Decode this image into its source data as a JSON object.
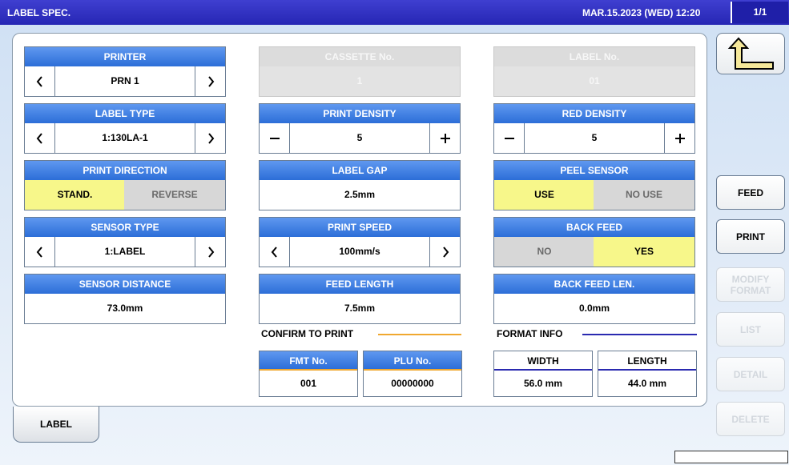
{
  "titlebar": {
    "title": "LABEL SPEC.",
    "datetime": "MAR.15.2023 (WED)  12:20",
    "page": "1/1"
  },
  "groups": {
    "printer": {
      "title": "PRINTER",
      "value": "PRN 1"
    },
    "cassette": {
      "title": "CASSETTE No.",
      "value": "1"
    },
    "label_no": {
      "title": "LABEL No.",
      "value": "01"
    },
    "label_type": {
      "title": "LABEL TYPE",
      "value": "1:130LA-1"
    },
    "print_density": {
      "title": "PRINT DENSITY",
      "value": "5"
    },
    "red_density": {
      "title": "RED DENSITY",
      "value": "5"
    },
    "print_direction": {
      "title": "PRINT DIRECTION",
      "option1": "STAND.",
      "option2": "REVERSE",
      "selected": "STAND."
    },
    "label_gap": {
      "title": "LABEL GAP",
      "value": "2.5mm"
    },
    "peel_sensor": {
      "title": "PEEL SENSOR",
      "option1": "USE",
      "option2": "NO USE",
      "selected": "USE"
    },
    "sensor_type": {
      "title": "SENSOR TYPE",
      "value": "1:LABEL"
    },
    "print_speed": {
      "title": "PRINT SPEED",
      "value": "100mm/s"
    },
    "back_feed": {
      "title": "BACK FEED",
      "option1": "NO",
      "option2": "YES",
      "selected": "YES"
    },
    "sensor_distance": {
      "title": "SENSOR DISTANCE",
      "value": "73.0mm"
    },
    "feed_length": {
      "title": "FEED LENGTH",
      "value": "7.5mm"
    },
    "back_feed_len": {
      "title": "BACK FEED LEN.",
      "value": "0.0mm"
    }
  },
  "confirm": {
    "title": "CONFIRM TO PRINT",
    "fmt": {
      "label": "FMT No.",
      "value": "001"
    },
    "plu": {
      "label": "PLU No.",
      "value": "00000000"
    }
  },
  "format_info": {
    "title": "FORMAT INFO",
    "width": {
      "label": "WIDTH",
      "value": "56.0 mm"
    },
    "length": {
      "label": "LENGTH",
      "value": "44.0 mm"
    }
  },
  "sidebar": {
    "feed": "FEED",
    "print": "PRINT",
    "modify_line1": "MODIFY",
    "modify_line2": "FORMAT",
    "list": "LIST",
    "detail": "DETAIL",
    "delete": "DELETE"
  },
  "tabs": {
    "label": "LABEL"
  },
  "icons": {
    "back": "return-arrow-icon",
    "decrease": "chevron-left-icon",
    "increase": "chevron-right-icon",
    "minus": "minus-icon",
    "plus": "plus-icon"
  },
  "colors": {
    "titlebar": "#2a2ab8",
    "group_header": "#3c7ce0",
    "selected_toggle": "#f7f78a",
    "unselected_toggle": "#d7d7d7",
    "confirm_line": "#f0a830",
    "format_line": "#2a2ab0"
  }
}
